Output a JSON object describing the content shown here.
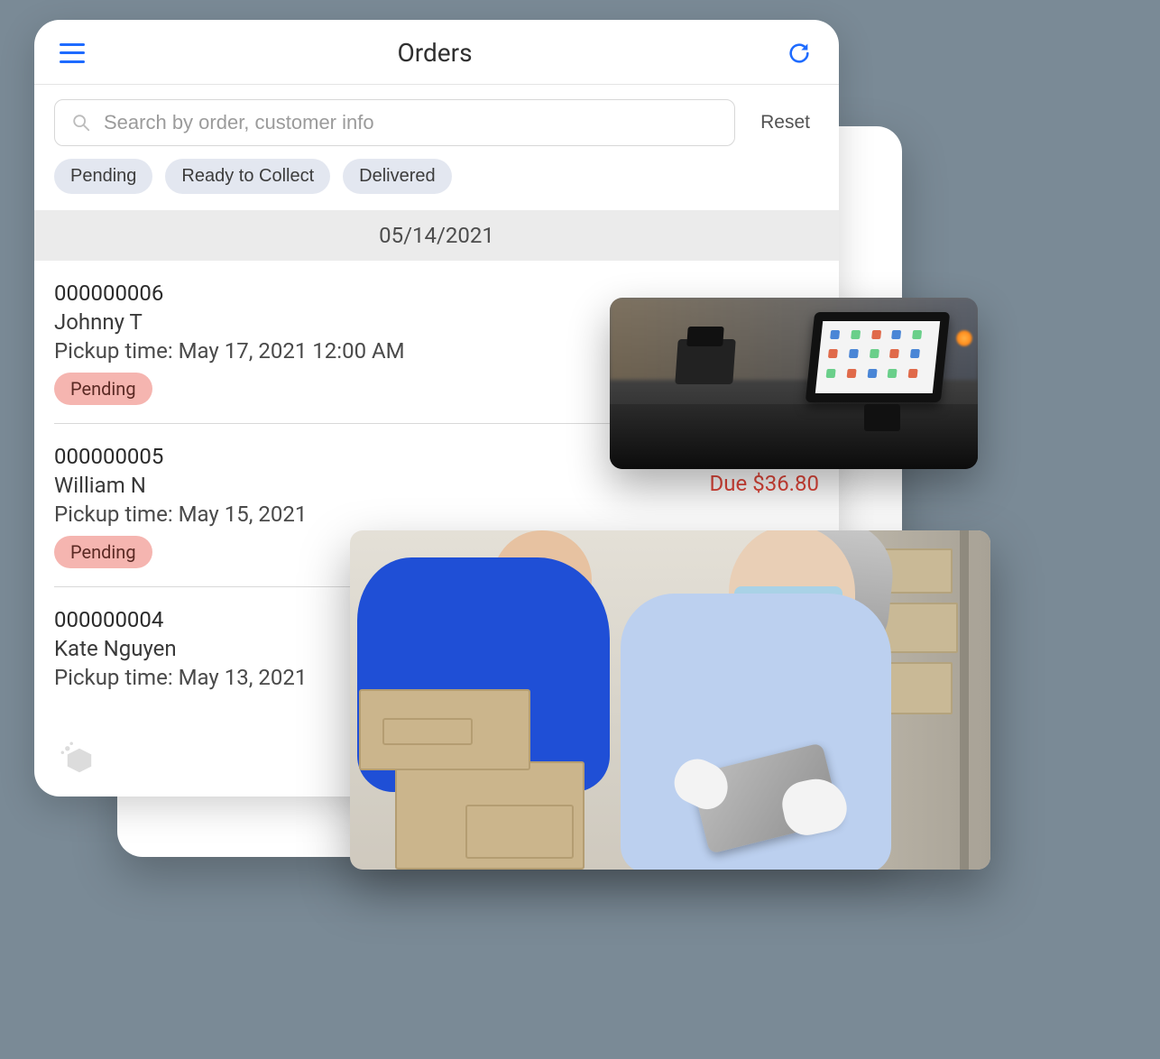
{
  "header": {
    "title": "Orders"
  },
  "search": {
    "placeholder": "Search by order, customer info",
    "reset_label": "Reset"
  },
  "filters": {
    "pending": "Pending",
    "ready": "Ready to Collect",
    "delivered": "Delivered"
  },
  "date_heading": "05/14/2021",
  "labels": {
    "pickup_prefix": "Pickup time: ",
    "due_prefix": "Due "
  },
  "orders": [
    {
      "number": "000000006",
      "customer": "Johnny T",
      "pickup": "May 17, 2021 12:00 AM",
      "status": "Pending",
      "price": "",
      "due": ""
    },
    {
      "number": "000000005",
      "customer": "William N",
      "pickup": "May 15, 2021",
      "status": "Pending",
      "price": "$36.80",
      "due": "$36.80"
    },
    {
      "number": "000000004",
      "customer": "Kate Nguyen",
      "pickup": "May 13, 2021",
      "status": "",
      "price": "",
      "due": ""
    }
  ],
  "colors": {
    "accent_blue": "#1e6bff",
    "badge_bg": "#f5b5b0",
    "due_red": "#e0463a",
    "chip_bg": "#e3e7f0"
  }
}
